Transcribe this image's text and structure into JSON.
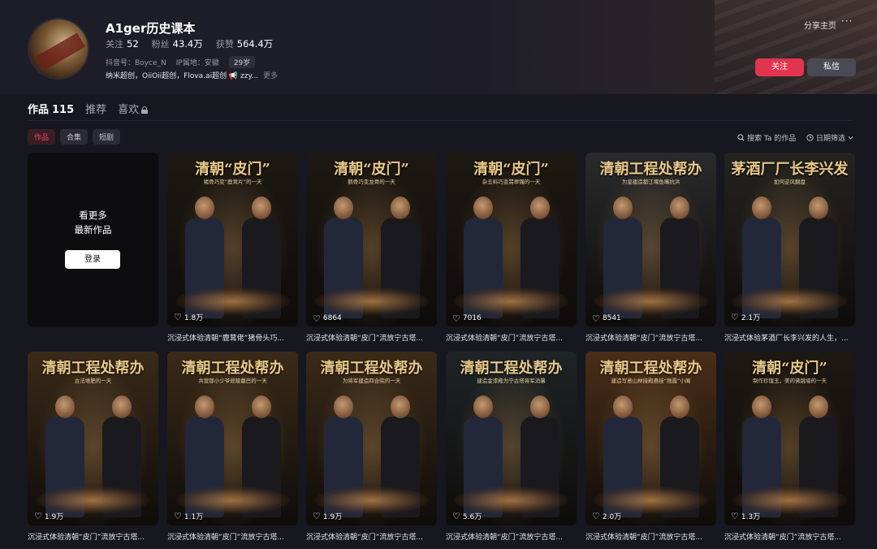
{
  "profile": {
    "name": "A1ger历史课本",
    "follow_label": "关注",
    "follow_count": "52",
    "fans_label": "粉丝",
    "fans_count": "43.4万",
    "likes_label": "获赞",
    "likes_count": "564.4万",
    "douyin_id": "抖音号：Boyce_N",
    "ip": "IP属地：安徽",
    "age": "29岁",
    "bio": "纳米超创，OiiOii超创，Flova.ai超创 📢 zzy...",
    "bio_more": "更多"
  },
  "header_actions": {
    "share": "分享主页",
    "more": "···",
    "follow_button": "关注",
    "message_button": "私信"
  },
  "tabs": [
    {
      "label": "作品",
      "count": "115"
    },
    {
      "label": "推荐"
    },
    {
      "label": "喜欢"
    }
  ],
  "chips": [
    "作品",
    "合集",
    "短剧"
  ],
  "tools": {
    "search": "搜索 Ta 的作品",
    "date": "日期筛选"
  },
  "login_card": {
    "line1": "看更多",
    "line2": "最新作品",
    "button": "登录"
  },
  "videos": [
    {
      "title": "清朝“皮门”",
      "subtitle": "猪骨巧变“鹿茸片”的一天",
      "likes": "1.8万",
      "caption": "沉浸式体验清朝“鹿茸佬”猪骨头巧...",
      "theme": "dark"
    },
    {
      "title": "清朝“皮门”",
      "subtitle": "鹅骨巧变龙骨的一天",
      "likes": "6864",
      "caption": "沉浸式体验清朝“皮门”流放宁古塔...",
      "theme": "dark"
    },
    {
      "title": "清朝“皮门”",
      "subtitle": "杂五料巧变翡翠镯的一天",
      "likes": "7016",
      "caption": "沉浸式体验清朝“皮门”流放宁古塔...",
      "theme": "dark"
    },
    {
      "title": "清朝工程处帮办",
      "subtitle": "为皇建造都江堰鱼嘴抗洪",
      "likes": "8541",
      "caption": "沉浸式体验清朝“皮门”流放宁古塔...",
      "theme": "flood"
    },
    {
      "title": "茅酒厂厂长李兴发",
      "subtitle": "如何逆风翻盘",
      "likes": "2.1万",
      "caption": "沉浸式体验茅酒厂长李兴发的人生，...",
      "theme": "factory"
    },
    {
      "title": "清朝工程处帮办",
      "subtitle": "古法堆肥的一天",
      "likes": "1.9万",
      "caption": "沉浸式体验清朝“皮门”流放宁古塔...",
      "theme": "warm"
    },
    {
      "title": "清朝工程处帮办",
      "subtitle": "共营那小少爷修陵墓巴的一天",
      "likes": "1.1万",
      "caption": "沉浸式体验清朝“皮门”流放宁古塔...",
      "theme": "warm"
    },
    {
      "title": "清朝工程处帮办",
      "subtitle": "为将军建造四合院的一天",
      "likes": "1.9万",
      "caption": "沉浸式体验清朝“皮门”流放宁古塔...",
      "theme": "warm"
    },
    {
      "title": "清朝工程处帮办",
      "subtitle": "建造金漆殿为宁古塔将军消暑",
      "likes": "5.6万",
      "caption": "沉浸式体验清朝“皮门”流放宁古塔...",
      "theme": "night"
    },
    {
      "title": "清朝工程处帮办",
      "subtitle": "建造写意山林接殿悬挂“残霞”小阁",
      "likes": "2.0万",
      "caption": "沉浸式体验清朝“皮门”流放宁古塔...",
      "theme": "sunset"
    },
    {
      "title": "清朝“皮门”",
      "subtitle": "制作珍馐玉，美的佛跳墙的一天",
      "likes": "1.3万",
      "caption": "沉浸式体验清朝“皮门”流放宁古塔...",
      "theme": "dark"
    }
  ],
  "themes": {
    "dark": "#1d1812",
    "flood": "#2a2a2c",
    "factory": "#24231f",
    "warm": "#3a2a18",
    "night": "#1e2426",
    "sunset": "#4a2e18"
  }
}
